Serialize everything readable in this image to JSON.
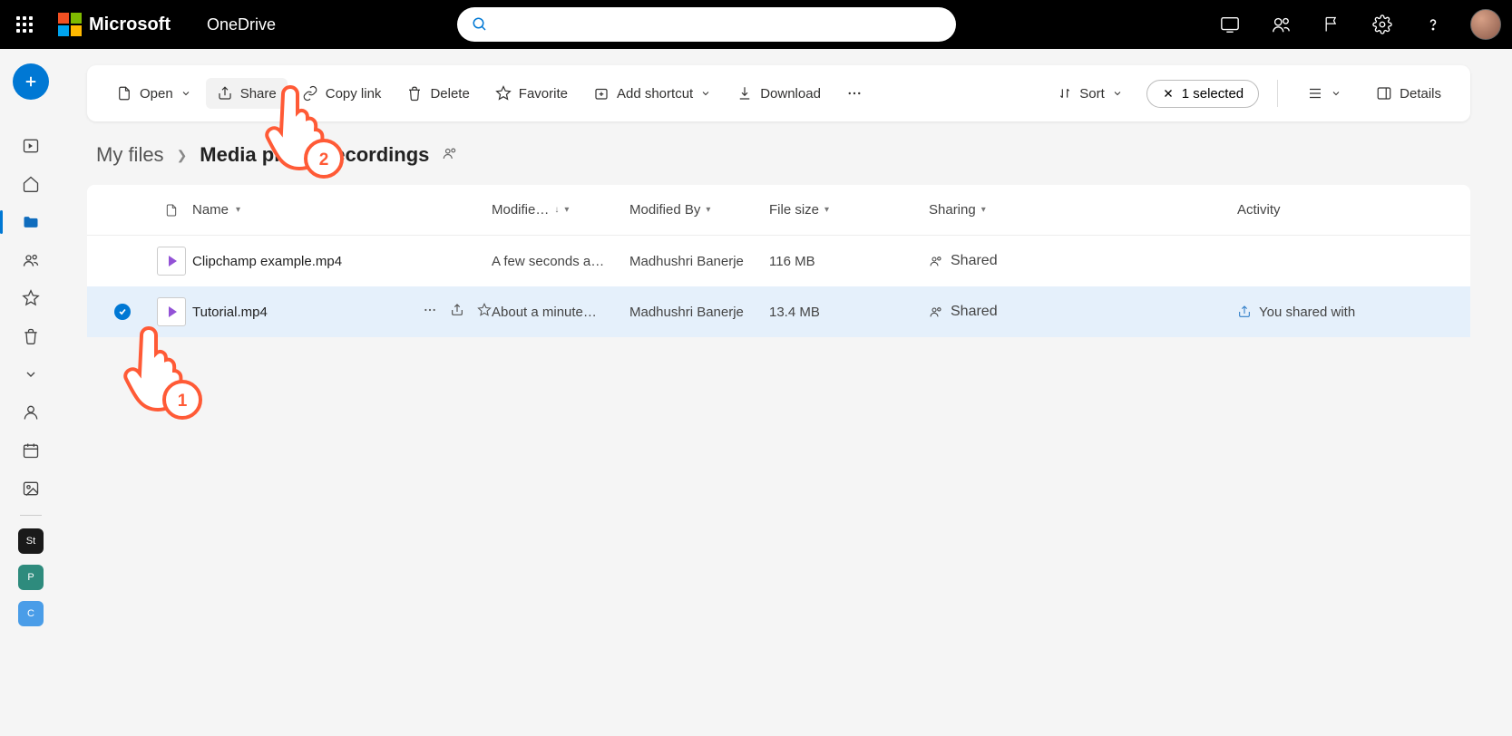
{
  "header": {
    "brand": "Microsoft",
    "app": "OneDrive"
  },
  "cmd": {
    "open": "Open",
    "share": "Share",
    "copy_link": "Copy link",
    "delete": "Delete",
    "favorite": "Favorite",
    "add_shortcut": "Add shortcut",
    "download": "Download",
    "sort": "Sort",
    "selected": "1 selected",
    "details": "Details"
  },
  "breadcrumb": {
    "root": "My files",
    "current": "Media player recordings"
  },
  "columns": {
    "name": "Name",
    "modified": "Modifie…",
    "modified_by": "Modified By",
    "file_size": "File size",
    "sharing": "Sharing",
    "activity": "Activity"
  },
  "rows": [
    {
      "name": "Clipchamp example.mp4",
      "modified": "A few seconds a…",
      "modified_by": "Madhushri Banerje",
      "size": "116 MB",
      "sharing": "Shared",
      "activity": "",
      "selected": false
    },
    {
      "name": "Tutorial.mp4",
      "modified": "About a minute…",
      "modified_by": "Madhushri Banerje",
      "size": "13.4 MB",
      "sharing": "Shared",
      "activity": "You shared with",
      "selected": true
    }
  ],
  "annotations": {
    "step1": "1",
    "step2": "2"
  }
}
